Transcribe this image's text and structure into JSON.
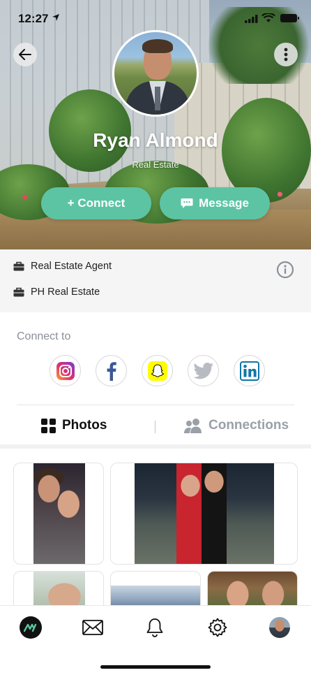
{
  "status_bar": {
    "time": "12:27"
  },
  "profile": {
    "name": "Ryan Almond",
    "subtitle": "Real Estate",
    "connect_label": "+ Connect",
    "message_label": "Message"
  },
  "info": {
    "job_title": "Real Estate Agent",
    "company": "PH Real Estate"
  },
  "connect_to": {
    "title": "Connect to",
    "socials": [
      {
        "icon": "instagram-icon"
      },
      {
        "icon": "facebook-icon"
      },
      {
        "icon": "snapchat-icon"
      },
      {
        "icon": "twitter-icon"
      },
      {
        "icon": "linkedin-icon"
      }
    ]
  },
  "tabs": {
    "photos": "Photos",
    "connections": "Connections",
    "active": "photos"
  },
  "colors": {
    "accent": "#5cc4a3",
    "inactive_tab": "#9aa0a8",
    "info_bg": "#f5f5f5"
  },
  "bottom_nav": [
    {
      "icon": "app-logo-icon"
    },
    {
      "icon": "mail-icon"
    },
    {
      "icon": "bell-icon"
    },
    {
      "icon": "gear-icon"
    },
    {
      "icon": "profile-avatar"
    }
  ]
}
